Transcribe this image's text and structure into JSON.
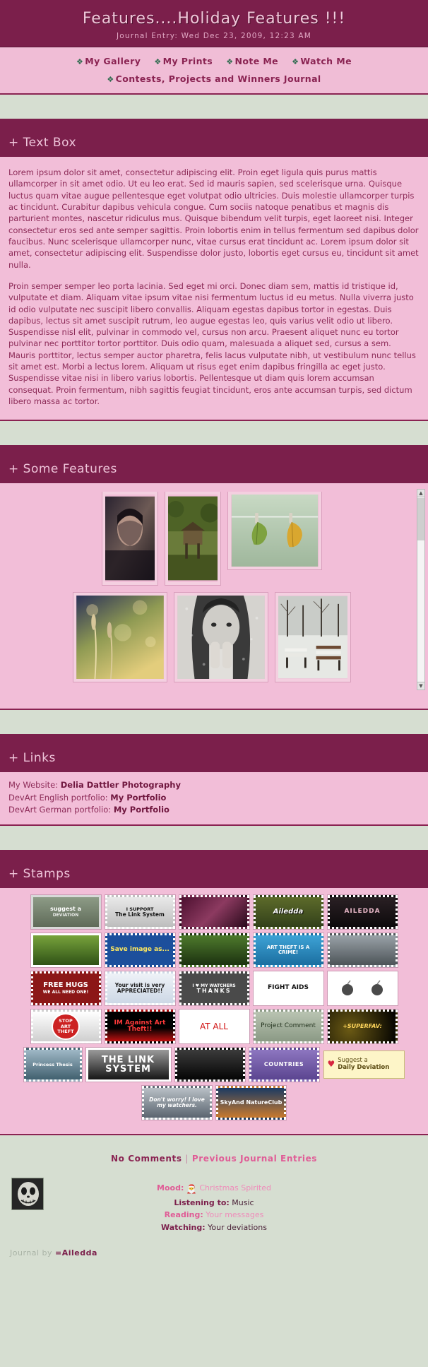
{
  "header": {
    "title": "Features....Holiday Features !!!",
    "date": "Journal Entry: Wed Dec 23, 2009, 12:23 AM",
    "nav": [
      {
        "label": "My Gallery"
      },
      {
        "label": "My Prints"
      },
      {
        "label": "Note Me"
      },
      {
        "label": "Watch Me"
      },
      {
        "label": "Contests, Projects and Winners Journal"
      }
    ]
  },
  "sections": {
    "textbox": {
      "heading": "+ Text Box",
      "paragraphs": [
        "Lorem ipsum dolor sit amet, consectetur adipiscing elit. Proin eget ligula quis purus mattis ullamcorper in sit amet odio. Ut eu leo erat. Sed id mauris sapien, sed scelerisque urna. Quisque luctus quam vitae augue pellentesque eget volutpat odio ultricies. Duis molestie ullamcorper turpis ac tincidunt. Curabitur dapibus vehicula congue. Cum sociis natoque penatibus et magnis dis parturient montes, nascetur ridiculus mus. Quisque bibendum velit turpis, eget laoreet nisi. Integer consectetur eros sed ante semper sagittis. Proin lobortis enim in tellus fermentum sed dapibus dolor faucibus. Nunc scelerisque ullamcorper nunc, vitae cursus erat tincidunt ac. Lorem ipsum dolor sit amet, consectetur adipiscing elit. Suspendisse dolor justo, lobortis eget cursus eu, tincidunt sit amet nulla.",
        "Proin semper semper leo porta lacinia. Sed eget mi orci. Donec diam sem, mattis id tristique id, vulputate et diam. Aliquam vitae ipsum vitae nisi fermentum luctus id eu metus. Nulla viverra justo id odio vulputate nec suscipit libero convallis. Aliquam egestas dapibus tortor in egestas. Duis dapibus, lectus sit amet suscipit rutrum, leo augue egestas leo, quis varius velit odio ut libero. Suspendisse nisl elit, pulvinar in commodo vel, cursus non arcu. Praesent aliquet nunc eu tortor pulvinar nec porttitor tortor porttitor. Duis odio quam, malesuada a aliquet sed, cursus a sem. Mauris porttitor, lectus semper auctor pharetra, felis lacus vulputate nibh, ut vestibulum nunc tellus sit amet est. Morbi a lectus lorem. Aliquam ut risus eget enim dapibus fringilla ac eget justo. Suspendisse vitae nisi in libero varius lobortis. Pellentesque ut diam quis lorem accumsan consequat. Proin fermentum, nibh sagittis feugiat tincidunt, eros ante accumsan turpis, sed dictum libero massa ac tortor."
      ]
    },
    "features": {
      "heading": "+ Some Features",
      "thumbs_row1": [
        {
          "name": "portrait-veil-woman"
        },
        {
          "name": "forest-treehouse"
        },
        {
          "name": "leaves-on-clothesline"
        }
      ],
      "thumbs_row2": [
        {
          "name": "golden-bokeh-grass"
        },
        {
          "name": "woman-behind-rainy-window"
        },
        {
          "name": "snowy-park-benches"
        }
      ]
    },
    "links": {
      "heading": "+ Links",
      "items": [
        {
          "label": "My Website:",
          "link": "Delia Dattler Photography"
        },
        {
          "label": "DevArt English portfolio:",
          "link": "My Portfolio"
        },
        {
          "label": "DevArt German portfolio:",
          "link": "My Portfolio"
        }
      ]
    },
    "stamps": {
      "heading": "+ Stamps",
      "rows": [
        [
          {
            "name": "suggest-a-deviation-stamp",
            "text": "suggest a",
            "sub": "DEVIATION"
          },
          {
            "name": "i-support-the-link-system-stamp",
            "text": "I SUPPORT",
            "sub": "The Link System"
          },
          {
            "name": "plain-maroon-stamp",
            "text": ""
          },
          {
            "name": "ailedda-flowers-stamp",
            "text": "Ailedda"
          },
          {
            "name": "ailedda-dark-stamp",
            "text": "AILEDDA"
          }
        ],
        [
          {
            "name": "green-grass-stamp",
            "text": ""
          },
          {
            "name": "save-image-as-stamp",
            "text": "Save image as..."
          },
          {
            "name": "ladybug-stamp",
            "text": ""
          },
          {
            "name": "art-theft-is-a-crime-stamp",
            "text": "ART THEFT IS A CRIME!"
          },
          {
            "name": "car-stamp",
            "text": ""
          }
        ],
        [
          {
            "name": "free-hugs-stamp",
            "text": "FREE HUGS",
            "sub": "WE ALL NEED ONE!"
          },
          {
            "name": "your-visit-is-appreciated-stamp",
            "text": "Your visit is very APPRECIATED!!"
          },
          {
            "name": "i-love-my-watchers-thanks-stamp",
            "text": "I ♥ MY WATCHERS",
            "sub": "THANKS"
          },
          {
            "name": "fight-aids-stamp",
            "text": "FIGHT AIDS"
          },
          {
            "name": "two-bombs-stamp",
            "text": ""
          }
        ],
        [
          {
            "name": "stop-art-theft-stamp",
            "text": "STOP ART THEFT"
          },
          {
            "name": "im-against-art-theft-stamp",
            "text": "IM Against Art Theft!!"
          },
          {
            "name": "at-all-stamp",
            "text": "AT ALL"
          },
          {
            "name": "project-comment-stamp",
            "text": "Project Comment"
          },
          {
            "name": "superfav-stamp",
            "text": "+SUPERFAV:"
          }
        ],
        [
          {
            "name": "princess-thesis-stamp",
            "text": "Princess Thesis"
          },
          {
            "name": "the-link-system-stamp",
            "text": "THE LINK SYSTEM"
          },
          {
            "name": "black-blank-stamp",
            "text": ""
          },
          {
            "name": "countries-stamp",
            "text": "COUNTRIES"
          }
        ],
        [
          {
            "name": "dont-worry-i-love-my-watchers-stamp",
            "text": "Don't worry! I love my watchers."
          },
          {
            "name": "sky-and-nature-club-stamp",
            "text": "SkyAnd NatureClub"
          }
        ]
      ],
      "suggest_widget": {
        "line1": "Suggest a",
        "line2": "Daily Deviation"
      }
    }
  },
  "footer": {
    "no_comments": "No Comments",
    "separator": "|",
    "previous_entries": "Previous Journal Entries",
    "meta": [
      {
        "label": "Mood:",
        "value": "Christmas Spirited",
        "icon": "santa-icon",
        "pink_label": true,
        "pink_value": true
      },
      {
        "label": "Listening to:",
        "value": "Music",
        "pink_label": false,
        "pink_value": false
      },
      {
        "label": "Reading:",
        "value": "Your messages",
        "pink_label": true,
        "pink_value": true
      },
      {
        "label": "Watching:",
        "value": "Your deviations",
        "pink_label": false,
        "pink_value": false
      }
    ],
    "journal_by_prefix": "Journal by ",
    "journal_by_author": "=Ailedda"
  },
  "colors": {
    "dark_plum": "#7b1f4b",
    "pink_body": "#f2bed8",
    "nav_pink": "#f0bdd6",
    "page_bg": "#d6ded1",
    "accent_text": "#8a2352",
    "link_pink": "#e05c96"
  }
}
